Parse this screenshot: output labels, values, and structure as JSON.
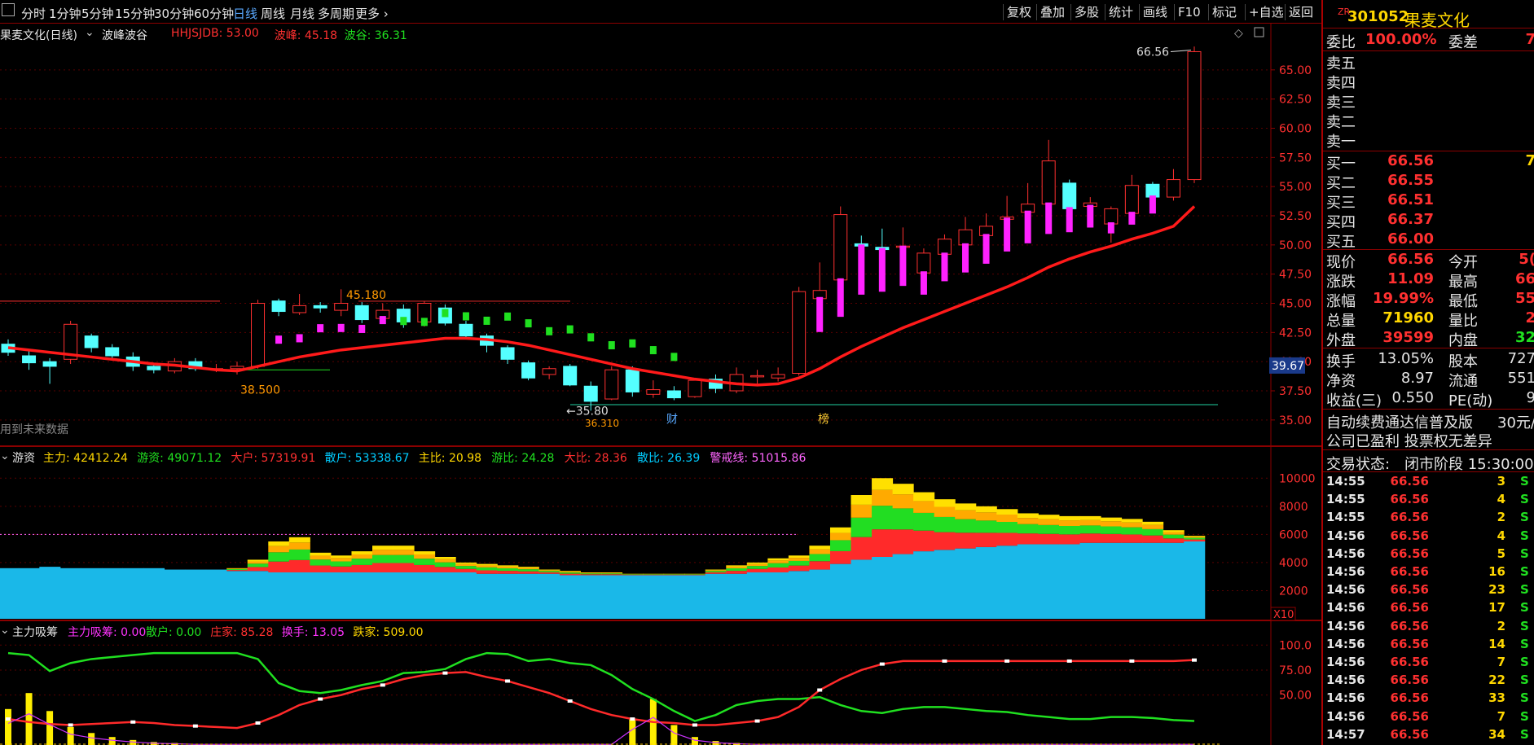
{
  "toolbar": {
    "periods": [
      "分时",
      "1分钟",
      "5分钟",
      "15分钟",
      "30分钟",
      "60分钟",
      "日线",
      "周线",
      "月线",
      "多周期",
      "更多"
    ],
    "active": "日线",
    "right_buttons": [
      "复权",
      "叠加",
      "多股",
      "统计",
      "画线",
      "F10",
      "标记",
      "+自选",
      "返回"
    ]
  },
  "main_pane": {
    "stock_title": "果麦文化(日线)",
    "indicator_name": "波峰波谷",
    "indicator_values": [
      {
        "text": "HHJSJDB: 53.00",
        "color": "#ff3030"
      },
      {
        "text": "波峰: 45.18",
        "color": "#ff3030"
      },
      {
        "text": "波谷: 36.31",
        "color": "#20e020"
      }
    ],
    "watermark": "用到未来数据",
    "price_labels": {
      "peak_top": "66.56",
      "level_1": "45.180",
      "level_2": "38.500",
      "level_3": "35.80",
      "level_4": "36.310"
    },
    "current_price_tag": "39.67",
    "markers": [
      "财",
      "榜"
    ],
    "y_axis": [
      "65.00",
      "62.50",
      "60.00",
      "57.50",
      "55.00",
      "52.50",
      "50.00",
      "47.50",
      "45.00",
      "42.50",
      "40.00",
      "37.50",
      "35.00"
    ]
  },
  "pane2": {
    "name": "游资",
    "values": [
      {
        "text": "主力: 42412.24",
        "color": "#ffd700"
      },
      {
        "text": "游资: 49071.12",
        "color": "#20e020"
      },
      {
        "text": "大户: 57319.91",
        "color": "#ff3030"
      },
      {
        "text": "散户: 53338.67",
        "color": "#00ccff"
      },
      {
        "text": "主比: 20.98",
        "color": "#ffd700"
      },
      {
        "text": "游比: 24.28",
        "color": "#20e020"
      },
      {
        "text": "大比: 28.36",
        "color": "#ff3030"
      },
      {
        "text": "散比: 26.39",
        "color": "#00ccff"
      },
      {
        "text": "警戒线: 51015.86",
        "color": "#ff66ff"
      }
    ],
    "y_axis": [
      "10000",
      "8000",
      "6000",
      "4000",
      "2000"
    ],
    "scale_tag": "X10"
  },
  "pane3": {
    "name": "主力吸筹",
    "values": [
      {
        "text": "主力吸筹: 0.00",
        "color": "#ff33ff"
      },
      {
        "text": "散户: 0.00",
        "color": "#20e020"
      },
      {
        "text": "庄家: 85.28",
        "color": "#ff3030"
      },
      {
        "text": "换手: 13.05",
        "color": "#ff33ff"
      },
      {
        "text": "跌家: 509.00",
        "color": "#ffd700"
      }
    ],
    "y_axis": [
      "100.0",
      "75.00",
      "50.00"
    ]
  },
  "quote": {
    "code": "301052",
    "name": "果麦文化",
    "badge": "ZR",
    "weibi_label": "委比",
    "weibi_value": "100.00%",
    "weicha_label": "委差",
    "weicha_value": "7",
    "sells": [
      {
        "label": "卖五"
      },
      {
        "label": "卖四"
      },
      {
        "label": "卖三"
      },
      {
        "label": "卖二"
      },
      {
        "label": "卖一"
      }
    ],
    "buys": [
      {
        "label": "买一",
        "price": "66.56",
        "vol": "7"
      },
      {
        "label": "买二",
        "price": "66.55",
        "vol": ""
      },
      {
        "label": "买三",
        "price": "66.51",
        "vol": ""
      },
      {
        "label": "买四",
        "price": "66.37",
        "vol": ""
      },
      {
        "label": "买五",
        "price": "66.00",
        "vol": ""
      }
    ],
    "stats": [
      {
        "l1": "现价",
        "v1": "66.56",
        "c1": "#ff3030",
        "l2": "今开",
        "v2": "5(",
        "c2": "#ff3030"
      },
      {
        "l1": "涨跌",
        "v1": "11.09",
        "c1": "#ff3030",
        "l2": "最高",
        "v2": "66",
        "c2": "#ff3030"
      },
      {
        "l1": "涨幅",
        "v1": "19.99%",
        "c1": "#ff3030",
        "l2": "最低",
        "v2": "55",
        "c2": "#ff3030"
      },
      {
        "l1": "总量",
        "v1": "71960",
        "c1": "#ffd700",
        "l2": "量比",
        "v2": "2",
        "c2": "#ff3030"
      },
      {
        "l1": "外盘",
        "v1": "39599",
        "c1": "#ff3030",
        "l2": "内盘",
        "v2": "32",
        "c2": "#20e020"
      }
    ],
    "fund": [
      {
        "l1": "换手",
        "v1": "13.05%",
        "l2": "股本",
        "v2": "727"
      },
      {
        "l1": "净资",
        "v1": "8.97",
        "l2": "流通",
        "v2": "551"
      },
      {
        "l1": "收益(三)",
        "v1": "0.550",
        "l2": "PE(动)",
        "v2": "9"
      }
    ],
    "ad1": "自动续费通达信普及版",
    "ad1_price": "30元/",
    "ad2": "公司已盈利 投票权无差异",
    "status_label": "交易状态:",
    "status_value": "闭市阶段 15:30:00",
    "trades": [
      {
        "time": "14:55",
        "price": "66.56",
        "vol": "3",
        "side": "S"
      },
      {
        "time": "14:55",
        "price": "66.56",
        "vol": "4",
        "side": "S"
      },
      {
        "time": "14:55",
        "price": "66.56",
        "vol": "2",
        "side": "S"
      },
      {
        "time": "14:56",
        "price": "66.56",
        "vol": "4",
        "side": "S"
      },
      {
        "time": "14:56",
        "price": "66.56",
        "vol": "5",
        "side": "S"
      },
      {
        "time": "14:56",
        "price": "66.56",
        "vol": "16",
        "side": "S"
      },
      {
        "time": "14:56",
        "price": "66.56",
        "vol": "23",
        "side": "S"
      },
      {
        "time": "14:56",
        "price": "66.56",
        "vol": "17",
        "side": "S"
      },
      {
        "time": "14:56",
        "price": "66.56",
        "vol": "2",
        "side": "S"
      },
      {
        "time": "14:56",
        "price": "66.56",
        "vol": "14",
        "side": "S"
      },
      {
        "time": "14:56",
        "price": "66.56",
        "vol": "7",
        "side": "S"
      },
      {
        "time": "14:56",
        "price": "66.56",
        "vol": "22",
        "side": "S"
      },
      {
        "time": "14:56",
        "price": "66.56",
        "vol": "33",
        "side": "S"
      },
      {
        "time": "14:56",
        "price": "66.56",
        "vol": "7",
        "side": "S"
      },
      {
        "time": "14:57",
        "price": "66.56",
        "vol": "34",
        "side": "S"
      }
    ]
  },
  "chart_data": {
    "type": "candlestick",
    "y_range": [
      35,
      67
    ],
    "candles": [
      [
        41.5,
        40.8,
        41.9,
        40.5
      ],
      [
        40.5,
        39.9,
        41.0,
        39.3
      ],
      [
        40.0,
        39.6,
        40.3,
        38.1
      ],
      [
        40.2,
        43.2,
        43.5,
        39.8
      ],
      [
        42.2,
        41.2,
        42.4,
        40.8
      ],
      [
        41.2,
        40.5,
        41.5,
        40.1
      ],
      [
        40.4,
        39.6,
        40.8,
        39.2
      ],
      [
        39.6,
        39.3,
        39.8,
        39.0
      ],
      [
        39.2,
        40.0,
        40.3,
        39.0
      ],
      [
        40.0,
        39.4,
        40.3,
        39.2
      ],
      [
        39.3,
        39.4,
        39.8,
        39.1
      ],
      [
        39.4,
        39.6,
        40.0,
        38.9
      ],
      [
        39.6,
        45.0,
        45.3,
        39.4
      ],
      [
        45.2,
        44.3,
        45.4,
        43.9
      ],
      [
        44.2,
        44.8,
        45.8,
        44.0
      ],
      [
        44.8,
        44.6,
        45.1,
        44.2
      ],
      [
        44.4,
        45.0,
        46.2,
        43.9
      ],
      [
        44.8,
        43.6,
        45.1,
        43.3
      ],
      [
        43.7,
        44.4,
        45.0,
        43.4
      ],
      [
        44.5,
        43.4,
        44.9,
        42.9
      ],
      [
        43.4,
        45.0,
        45.2,
        43.0
      ],
      [
        44.6,
        43.3,
        44.9,
        43.1
      ],
      [
        43.2,
        42.2,
        43.5,
        42.0
      ],
      [
        42.2,
        41.4,
        42.4,
        40.8
      ],
      [
        41.2,
        40.2,
        41.4,
        39.8
      ],
      [
        39.9,
        38.6,
        40.1,
        38.4
      ],
      [
        38.9,
        39.4,
        39.6,
        38.5
      ],
      [
        39.6,
        38.0,
        39.8,
        37.9
      ],
      [
        37.9,
        36.6,
        38.3,
        35.8
      ],
      [
        36.8,
        39.3,
        39.6,
        36.7
      ],
      [
        39.3,
        37.4,
        39.6,
        37.0
      ],
      [
        37.2,
        37.6,
        38.4,
        36.9
      ],
      [
        37.5,
        36.9,
        37.9,
        36.7
      ],
      [
        37.0,
        38.4,
        38.6,
        36.9
      ],
      [
        38.5,
        37.7,
        38.9,
        37.3
      ],
      [
        37.5,
        38.9,
        39.5,
        37.3
      ],
      [
        38.8,
        38.8,
        39.3,
        38.1
      ],
      [
        38.6,
        38.9,
        39.5,
        38.3
      ],
      [
        39.0,
        46.0,
        46.4,
        38.8
      ],
      [
        45.4,
        46.1,
        48.5,
        45.1
      ],
      [
        47.0,
        52.6,
        53.3,
        46.3
      ],
      [
        50.1,
        49.9,
        50.8,
        49.6
      ],
      [
        49.8,
        49.6,
        51.4,
        48.9
      ],
      [
        49.8,
        49.9,
        51.5,
        49.2
      ],
      [
        47.6,
        49.3,
        49.7,
        47.0
      ],
      [
        49.2,
        50.5,
        50.9,
        48.8
      ],
      [
        50.0,
        51.3,
        52.4,
        49.0
      ],
      [
        50.8,
        51.6,
        52.7,
        50.2
      ],
      [
        52.2,
        52.4,
        54.2,
        51.8
      ],
      [
        52.8,
        53.5,
        55.3,
        52.7
      ],
      [
        53.5,
        57.2,
        59.0,
        53.3
      ],
      [
        55.3,
        53.1,
        55.6,
        52.6
      ],
      [
        53.3,
        53.6,
        54.1,
        51.6
      ],
      [
        51.8,
        53.1,
        53.3,
        50.2
      ],
      [
        52.7,
        55.1,
        56.0,
        52.6
      ],
      [
        55.2,
        54.1,
        55.4,
        53.6
      ],
      [
        54.1,
        55.6,
        56.5,
        53.8
      ],
      [
        55.6,
        66.56,
        67.0,
        55.3
      ]
    ],
    "ma_line": [
      41.2,
      41.0,
      40.8,
      40.6,
      40.4,
      40.2,
      40.0,
      39.8,
      39.7,
      39.5,
      39.3,
      39.2,
      39.6,
      40.0,
      40.4,
      40.7,
      41.0,
      41.2,
      41.4,
      41.6,
      41.8,
      42.0,
      42.0,
      41.9,
      41.7,
      41.4,
      41.0,
      40.6,
      40.2,
      39.8,
      39.4,
      39.1,
      38.8,
      38.5,
      38.3,
      38.1,
      38.0,
      38.1,
      38.6,
      39.4,
      40.4,
      41.3,
      42.1,
      42.9,
      43.6,
      44.3,
      45.0,
      45.7,
      46.4,
      47.2,
      48.1,
      48.8,
      49.4,
      49.9,
      50.5,
      51.0,
      51.6,
      53.3
    ],
    "pane2_base": [
      3600,
      3600,
      3700,
      3600,
      3600,
      3600,
      3600,
      3600,
      3500,
      3500,
      3500,
      3400,
      3400,
      3300,
      3300,
      3300,
      3300,
      3300,
      3300,
      3300,
      3300,
      3300,
      3300,
      3200,
      3200,
      3200,
      3200,
      3100,
      3100,
      3100,
      3100,
      3100,
      3100,
      3100,
      3200,
      3200,
      3300,
      3300,
      3400,
      3500,
      3900,
      4200,
      4400,
      4600,
      4800,
      4900,
      5000,
      5100,
      5200,
      5300,
      5300,
      5300,
      5400,
      5400,
      5400,
      5400,
      5400,
      5500
    ],
    "pane2_top": [
      3600,
      3600,
      3700,
      3600,
      3600,
      3600,
      3600,
      3600,
      3500,
      3500,
      3500,
      3600,
      4200,
      5500,
      5800,
      4700,
      4500,
      4800,
      5200,
      5200,
      4800,
      4400,
      4000,
      3900,
      3800,
      3700,
      3500,
      3400,
      3300,
      3300,
      3200,
      3200,
      3200,
      3200,
      3500,
      3800,
      4000,
      4300,
      4500,
      5200,
      6500,
      8800,
      10000,
      9600,
      9000,
      8500,
      8200,
      8000,
      7800,
      7500,
      7400,
      7300,
      7300,
      7200,
      7100,
      6900,
      6300,
      5900
    ],
    "pane3_red": [
      26,
      23,
      21,
      20,
      21,
      22,
      23,
      22,
      20,
      19,
      18,
      17,
      22,
      30,
      40,
      46,
      50,
      56,
      60,
      66,
      70,
      72,
      73,
      68,
      64,
      58,
      52,
      44,
      36,
      30,
      26,
      23,
      22,
      20,
      20,
      22,
      24,
      28,
      38,
      55,
      66,
      75,
      81,
      84,
      84,
      84,
      84,
      84,
      84,
      84,
      84,
      84,
      84,
      84,
      84,
      84,
      84,
      85
    ],
    "pane3_green": [
      92,
      90,
      74,
      82,
      86,
      88,
      90,
      92,
      92,
      92,
      92,
      92,
      86,
      62,
      54,
      52,
      55,
      60,
      64,
      72,
      73,
      76,
      86,
      92,
      91,
      84,
      86,
      82,
      80,
      70,
      56,
      46,
      34,
      24,
      30,
      40,
      44,
      46,
      46,
      48,
      40,
      34,
      32,
      36,
      38,
      38,
      36,
      34,
      33,
      30,
      28,
      26,
      26,
      28,
      28,
      27,
      25,
      24
    ],
    "pane3_bars": [
      36,
      52,
      34,
      18,
      12,
      8,
      5,
      3,
      2,
      1,
      1,
      1,
      1,
      1,
      1,
      1,
      1,
      1,
      1,
      1,
      1,
      1,
      1,
      1,
      1,
      1,
      1,
      1,
      1,
      1,
      26,
      46,
      20,
      8,
      4,
      2,
      1,
      1,
      1,
      1,
      1,
      1,
      1,
      1,
      1,
      1,
      1,
      1,
      1,
      1,
      1,
      1,
      1,
      1,
      1,
      1,
      1,
      1
    ]
  }
}
